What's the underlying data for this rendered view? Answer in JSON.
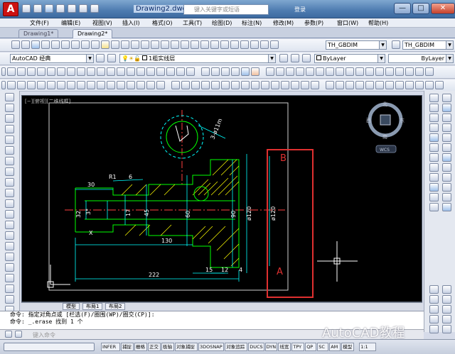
{
  "window": {
    "doc_title": "Drawing2.dwg",
    "search_placeholder": "键入关键字或短语",
    "login": "登录",
    "controls": [
      "—",
      "□",
      "✕"
    ]
  },
  "menu": [
    "文件(F)",
    "编辑(E)",
    "视图(V)",
    "插入(I)",
    "格式(O)",
    "工具(T)",
    "绘图(D)",
    "标注(N)",
    "修改(M)",
    "参数(P)",
    "窗口(W)",
    "帮助(H)"
  ],
  "doc_tabs": [
    "Drawing1*",
    "Drawing2*"
  ],
  "toolbar": {
    "style_combo": "TH_GBDIM",
    "style_combo2": "TH_GBDIM",
    "workspace": "AutoCAD 经典",
    "layer": "1粗实线层",
    "color": "ByLayer",
    "linetype": "ByLayer"
  },
  "viewport": {
    "label": "[−][俯视][二维线框]",
    "compass": {
      "north": "北",
      "south": "南",
      "east": "东",
      "west": "西"
    },
    "ucs": "WCS",
    "markers": {
      "b": "B",
      "a": "A"
    },
    "annotation_box_color": "#e03030"
  },
  "drawing_dims": {
    "d_30": "30",
    "r1": "R1",
    "thread": "6",
    "d_130": "130",
    "d_222": "222",
    "d_15": "15",
    "d_12": "12",
    "d_4": "4",
    "d_32": "32",
    "d_3p": "3°",
    "d_17": "17",
    "d_45": "45",
    "d_60": "60",
    "d_90": "90",
    "d_120a": "ø120",
    "d_120b": "ø120",
    "x_mark": "X",
    "rv": "3-ø11m"
  },
  "layout_tabs": [
    "模型",
    "布局1",
    "布局2"
  ],
  "command": {
    "line1": "命令: 指定对角点或 [栏选(F)/圈围(WP)/圈交(CP)]:",
    "line2": "命令: _.erase 找到 1 个",
    "prompt": "键入命令"
  },
  "status": [
    "INFER",
    "捕捉",
    "栅格",
    "正交",
    "极轴",
    "对象捕捉",
    "3DOSNAP",
    "对象追踪",
    "DUCS",
    "DYN",
    "线宽",
    "TPY",
    "QP",
    "SC",
    "AM",
    "模型"
  ],
  "status_scale": "1:1",
  "watermark": "AutoCAD教程"
}
